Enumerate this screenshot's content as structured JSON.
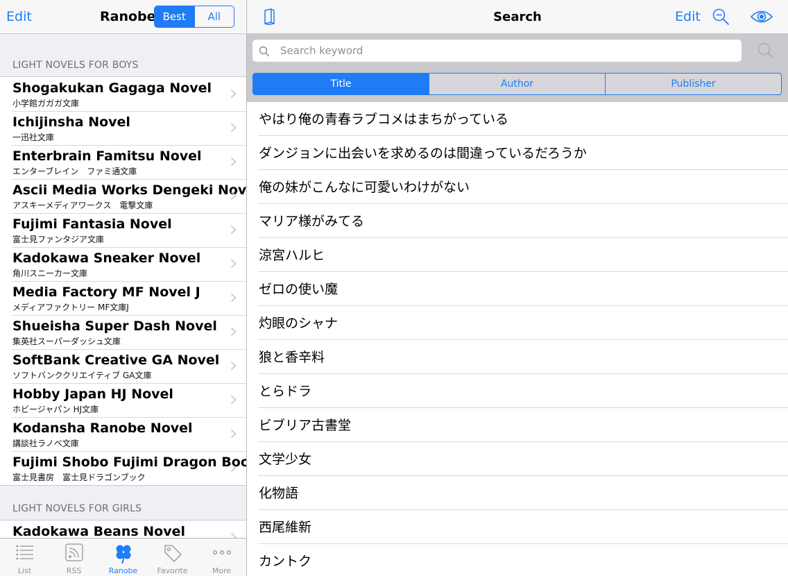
{
  "left_nav": {
    "edit_label": "Edit",
    "title": "Ranobe",
    "segments": [
      "Best",
      "All"
    ],
    "selected_segment": "Best"
  },
  "sections": [
    {
      "header": "LIGHT NOVELS FOR BOYS",
      "items": [
        {
          "title": "Shogakukan Gagaga Novel",
          "subtitle": "小学館ガガガ文庫"
        },
        {
          "title": "Ichijinsha Novel",
          "subtitle": "一迅社文庫"
        },
        {
          "title": "Enterbrain Famitsu Novel",
          "subtitle": "エンターブレイン　ファミ通文庫"
        },
        {
          "title": "Ascii Media Works Dengeki Novel",
          "subtitle": "アスキーメディアワークス　電撃文庫"
        },
        {
          "title": "Fujimi Fantasia Novel",
          "subtitle": "富士見ファンタジア文庫"
        },
        {
          "title": "Kadokawa Sneaker Novel",
          "subtitle": "角川スニーカー文庫"
        },
        {
          "title": "Media Factory MF Novel J",
          "subtitle": "メディアファクトリー MF文庫J"
        },
        {
          "title": "Shueisha Super Dash Novel",
          "subtitle": "集英社スーパーダッシュ文庫"
        },
        {
          "title": "SoftBank Creative GA Novel",
          "subtitle": "ソフトバンククリエイティブ GA文庫"
        },
        {
          "title": "Hobby Japan HJ Novel",
          "subtitle": "ホビージャパン HJ文庫"
        },
        {
          "title": "Kodansha Ranobe Novel",
          "subtitle": "講談社ラノベ文庫"
        },
        {
          "title": "Fujimi Shobo Fujimi Dragon Book",
          "subtitle": "富士見書房　富士見ドラゴンブック"
        }
      ]
    },
    {
      "header": "LIGHT NOVELS FOR GIRLS",
      "items": [
        {
          "title": "Kadokawa Beans Novel",
          "subtitle": ""
        }
      ]
    }
  ],
  "tab_bar": {
    "tabs": [
      {
        "label": "List",
        "icon": "list-icon"
      },
      {
        "label": "RSS",
        "icon": "rss-icon"
      },
      {
        "label": "Ranobe",
        "icon": "clover-icon"
      },
      {
        "label": "Favorite",
        "icon": "tag-icon"
      },
      {
        "label": "More",
        "icon": "more-icon"
      }
    ],
    "selected": "Ranobe"
  },
  "right_nav": {
    "title": "Search",
    "edit_label": "Edit",
    "icons": [
      "book-icon",
      "zoom-out-icon",
      "eye-icon"
    ]
  },
  "search": {
    "placeholder": "Search keyword",
    "value": ""
  },
  "search_scope": {
    "segments": [
      "Title",
      "Author",
      "Publisher"
    ],
    "selected": "Title"
  },
  "results": [
    "やはり俺の青春ラブコメはまちがっている",
    "ダンジョンに出会いを求めるのは間違っているだろうか",
    "俺の妹がこんなに可愛いわけがない",
    "マリア様がみてる",
    "涼宮ハルヒ",
    "ゼロの使い魔",
    "灼眼のシャナ",
    "狼と香辛料",
    "とらドラ",
    "ビブリア古書堂",
    "文学少女",
    "化物語",
    "西尾維新",
    "カントク"
  ],
  "colors": {
    "accent": "#1f7cf6",
    "bar_background": "#f7f7f7",
    "group_background": "#efeff4",
    "search_background": "#c9c9ce"
  }
}
